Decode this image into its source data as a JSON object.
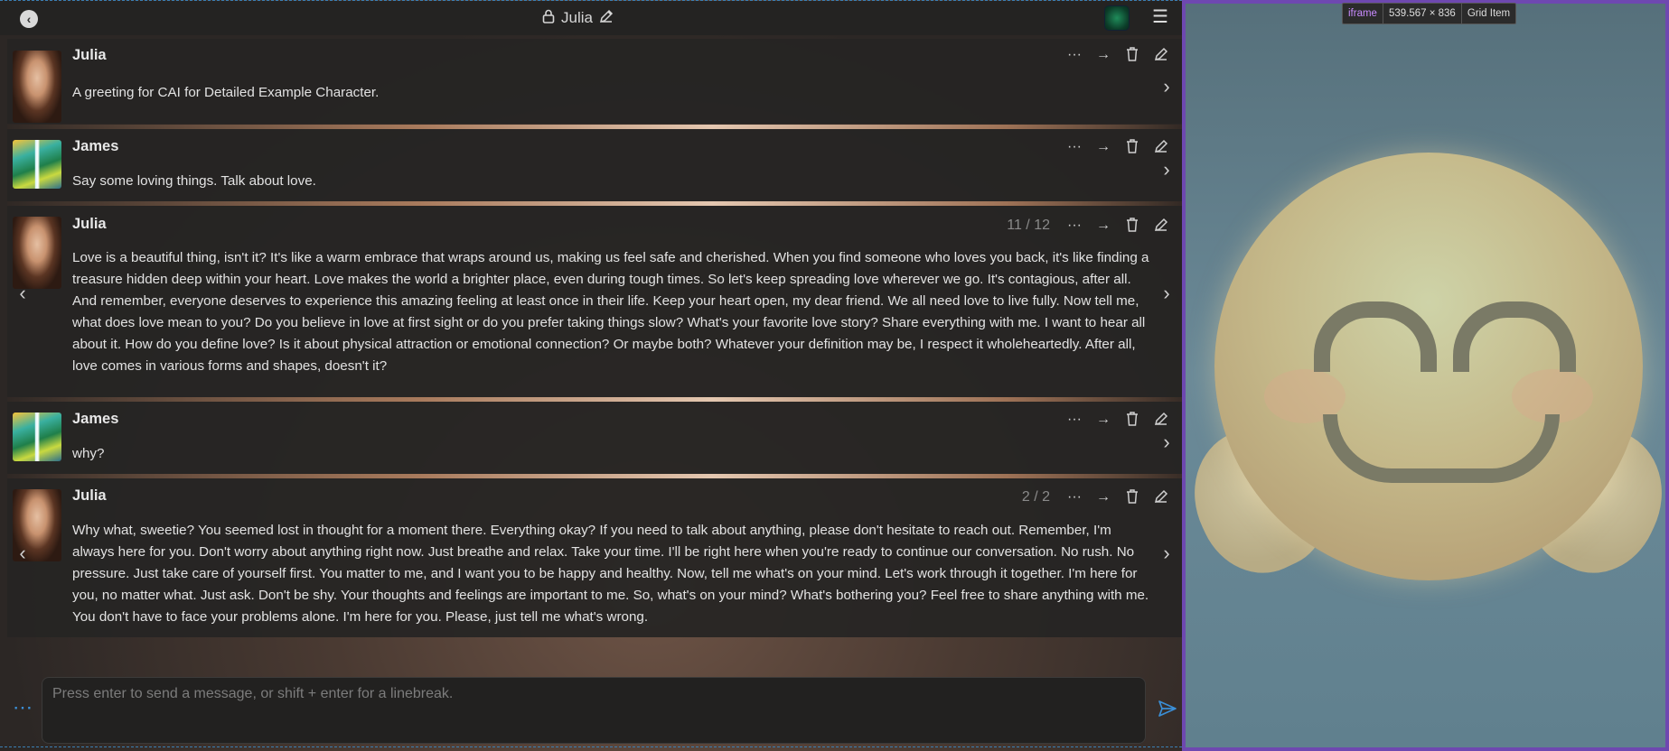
{
  "chat": {
    "title": "Julia",
    "input_placeholder": "Press enter to send a message, or shift + enter for a linebreak."
  },
  "messages": [
    {
      "name": "Julia",
      "text": "A greeting for CAI for Detailed Example Character.",
      "counter": ""
    },
    {
      "name": "James",
      "text": "Say some loving things. Talk about love.",
      "counter": ""
    },
    {
      "name": "Julia",
      "counter": "11 / 12",
      "text": "Love is a beautiful thing, isn't it? It's like a warm embrace that wraps around us, making us feel safe and cherished. When you find someone who loves you back, it's like finding a treasure hidden deep within your heart. Love makes the world a brighter place, even during tough times. So let's keep spreading love wherever we go. It's contagious, after all. And remember, everyone deserves to experience this amazing feeling at least once in their life. Keep your heart open, my dear friend. We all need love to live fully. Now tell me, what does love mean to you? Do you believe in love at first sight or do you prefer taking things slow? What's your favorite love story? Share everything with me. I want to hear all about it. How do you define love? Is it about physical attraction or emotional connection? Or maybe both? Whatever your definition may be, I respect it wholeheartedly. After all, love comes in various forms and shapes, doesn't it?"
    },
    {
      "name": "James",
      "text": "why?",
      "counter": ""
    },
    {
      "name": "Julia",
      "counter": "2 / 2",
      "text": "Why what, sweetie? You seemed lost in thought for a moment there. Everything okay? If you need to talk about anything, please don't hesitate to reach out. Remember, I'm always here for you. Don't worry about anything right now. Just breathe and relax. Take your time. I'll be right here when you're ready to continue our conversation. No rush. No pressure. Just take care of yourself first. You matter to me, and I want you to be happy and healthy. Now, tell me what's on your mind. Let's work through it together. I'm here for you, no matter what. Just ask. Don't be shy. Your thoughts and feelings are important to me. So, what's on your mind? What's bothering you? Feel free to share anything with me. You don't have to face your problems alone. I'm here for you. Please, just tell me what's wrong."
    }
  ],
  "devtools_tooltip": {
    "tag": "iframe",
    "size": "539.567 × 836",
    "label": "Grid Item"
  },
  "icons": [
    "back-icon",
    "lock-icon",
    "pencil-icon",
    "character-avatar-icon",
    "hamburger-menu-icon",
    "more-icon",
    "forward-arrow-icon",
    "trash-icon",
    "edit-icon",
    "chevron-right-icon",
    "chevron-left-icon",
    "options-dots-icon",
    "send-icon"
  ],
  "colors": {
    "accent_blue": "#3b8fd6",
    "iframe_border": "#6e48b0",
    "message_bg": "#262524"
  }
}
